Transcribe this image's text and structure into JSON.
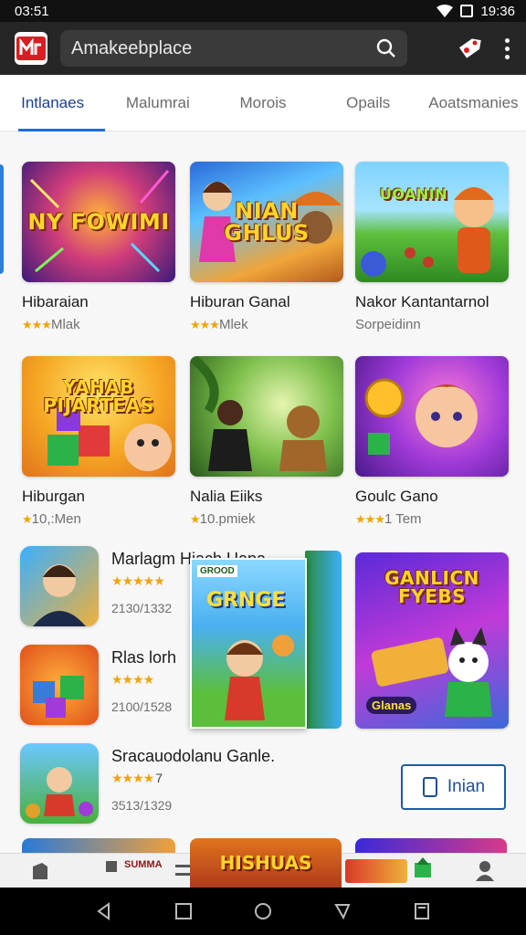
{
  "status_bar": {
    "time": "03:51",
    "right_time": "19:36"
  },
  "app_bar": {
    "search_placeholder": "Amakeebplace"
  },
  "tabs": [
    {
      "label": "Intlanaes",
      "active": true
    },
    {
      "label": "Malumrai",
      "active": false
    },
    {
      "label": "Morois",
      "active": false
    },
    {
      "label": "Opails",
      "active": false
    },
    {
      "label": "Aoatsmanies",
      "active": false
    }
  ],
  "grid_row1": [
    {
      "art_title": "NY FOWIMI",
      "name": "Hibaraian",
      "stars": "★★★",
      "sub": "Mlak"
    },
    {
      "art_title": "NIAN GHLUS",
      "name": "Hiburan Ganal",
      "stars": "★★★",
      "sub": "Mlek"
    },
    {
      "art_title": "UOANIN",
      "name": "Nakor Kantantarnol",
      "stars": "",
      "sub": "Sorpeidinn"
    }
  ],
  "grid_row2": [
    {
      "art_title": "YAHAB PIJARTEAS",
      "name": "Hiburgan",
      "stars": "★",
      "sub": "10,:Men"
    },
    {
      "art_title": "",
      "name": "Nalia Eiiks",
      "stars": "★",
      "sub": "10.pmiek"
    },
    {
      "art_title": "",
      "name": "Goulc Gano",
      "stars": "★★★",
      "sub": "1 Tem"
    }
  ],
  "list_items": [
    {
      "name": "Marlagm Hiach Uana",
      "stars": "★★★★★",
      "meta": "2130/1332"
    },
    {
      "name": "Rlas lorh",
      "stars": "★★★★",
      "meta": "2100/1528"
    },
    {
      "name": "Sracauodolanu Ganle.",
      "stars": "★★★★",
      "rating_num": "7",
      "meta": "3513/1329"
    }
  ],
  "featured": {
    "box_label": "GRNGE",
    "box_brand": "GROOD",
    "promo_title": "GANLICN FYEBS",
    "promo_sub": "Glanas"
  },
  "install_button": {
    "label": "Inian"
  },
  "bottom_shelf": {
    "center_label": "SUMMA",
    "art_title": "HISHUAS"
  },
  "colors": {
    "accent": "#1c6fd8",
    "star": "#f0a30a",
    "appbar": "#262626"
  }
}
